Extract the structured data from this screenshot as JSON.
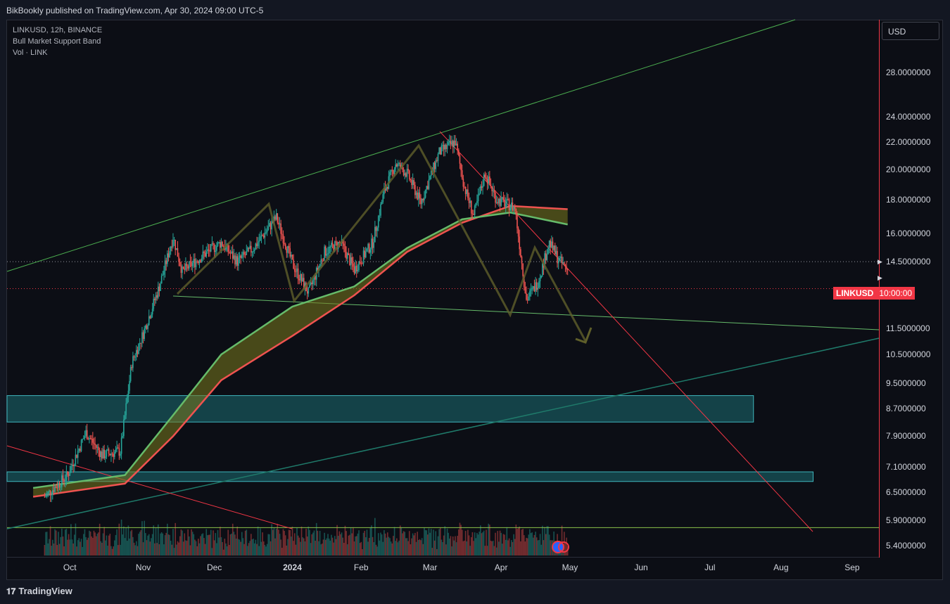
{
  "header": {
    "published": "BikBookly published on TradingView.com, Apr 30, 2024 09:00 UTC-5"
  },
  "legend": {
    "symbol_line": "LINKUSD, 12h, BINANCE",
    "indicator": "Bull Market Support Band",
    "volume": "Vol · LINK"
  },
  "currency": "USD",
  "last_price_label": {
    "symbol": "LINKUSD",
    "countdown": "10:00:00"
  },
  "footer": {
    "brand": "TradingView",
    "logo_icon": "tradingview-logo-icon"
  },
  "colors": {
    "up": "#26a69a",
    "down": "#ef5350",
    "band_fast": "#66bb6a",
    "band_slow": "#ef5350",
    "trendline_green": "#4caf50",
    "trendline_red": "#f23645",
    "zone": "#1b6e73"
  },
  "chart_data": {
    "type": "candlestick",
    "symbol": "LINKUSD",
    "interval": "12h",
    "exchange": "BINANCE",
    "scale": "log",
    "y_tick_labels": [
      "28.0000000",
      "24.0000000",
      "22.0000000",
      "20.0000000",
      "18.0000000",
      "16.0000000",
      "14.5000000",
      "11.5000000",
      "10.5000000",
      "9.5000000",
      "8.7000000",
      "7.9000000",
      "7.1000000",
      "6.5000000",
      "5.9000000",
      "5.4000000"
    ],
    "x_tick_labels": [
      "Oct",
      "Nov",
      "Dec",
      "2024",
      "Feb",
      "Mar",
      "Apr",
      "May",
      "Jun",
      "Jul",
      "Aug",
      "Sep"
    ],
    "price_path": [
      [
        "2023-09-15",
        6.4
      ],
      [
        "2023-09-25",
        6.9
      ],
      [
        "2023-10-03",
        8.0
      ],
      [
        "2023-10-10",
        7.4
      ],
      [
        "2023-10-18",
        7.5
      ],
      [
        "2023-10-23",
        10.2
      ],
      [
        "2023-10-28",
        11.3
      ],
      [
        "2023-11-04",
        13.3
      ],
      [
        "2023-11-10",
        15.8
      ],
      [
        "2023-11-14",
        14.0
      ],
      [
        "2023-11-25",
        15.0
      ],
      [
        "2023-12-01",
        15.5
      ],
      [
        "2023-12-08",
        14.5
      ],
      [
        "2023-12-15",
        15.2
      ],
      [
        "2023-12-25",
        16.9
      ],
      [
        "2024-01-01",
        14.4
      ],
      [
        "2024-01-08",
        13.0
      ],
      [
        "2024-01-15",
        15.0
      ],
      [
        "2024-01-22",
        15.5
      ],
      [
        "2024-01-28",
        14.1
      ],
      [
        "2024-02-05",
        15.5
      ],
      [
        "2024-02-10",
        18.5
      ],
      [
        "2024-02-15",
        20.4
      ],
      [
        "2024-02-20",
        19.7
      ],
      [
        "2024-02-26",
        17.8
      ],
      [
        "2024-03-05",
        21.2
      ],
      [
        "2024-03-12",
        22.0
      ],
      [
        "2024-03-16",
        18.8
      ],
      [
        "2024-03-20",
        17.0
      ],
      [
        "2024-03-25",
        19.7
      ],
      [
        "2024-03-30",
        18.0
      ],
      [
        "2024-04-07",
        17.5
      ],
      [
        "2024-04-12",
        12.7
      ],
      [
        "2024-04-17",
        13.5
      ],
      [
        "2024-04-22",
        15.5
      ],
      [
        "2024-04-26",
        14.6
      ],
      [
        "2024-04-30",
        14.1
      ]
    ],
    "last_price": 14.1,
    "bull_market_support_band": {
      "fast": [
        [
          "2023-09-10",
          6.6
        ],
        [
          "2023-10-20",
          6.9
        ],
        [
          "2023-11-10",
          8.5
        ],
        [
          "2023-12-01",
          10.5
        ],
        [
          "2024-01-01",
          12.4
        ],
        [
          "2024-01-28",
          13.3
        ],
        [
          "2024-02-20",
          15.2
        ],
        [
          "2024-03-15",
          16.8
        ],
        [
          "2024-04-05",
          17.2
        ],
        [
          "2024-04-30",
          16.5
        ]
      ],
      "slow": [
        [
          "2023-09-10",
          6.4
        ],
        [
          "2023-10-20",
          6.7
        ],
        [
          "2023-11-10",
          7.9
        ],
        [
          "2023-12-01",
          9.6
        ],
        [
          "2024-01-01",
          11.2
        ],
        [
          "2024-01-28",
          12.9
        ],
        [
          "2024-02-20",
          15.0
        ],
        [
          "2024-03-15",
          16.6
        ],
        [
          "2024-04-05",
          17.6
        ],
        [
          "2024-04-30",
          17.4
        ]
      ]
    },
    "zones": [
      {
        "from": 8.3,
        "to": 9.1,
        "until": "2024-07-20"
      },
      {
        "from": 6.75,
        "to": 6.98,
        "until": "2024-08-15"
      }
    ],
    "horizontal_levels": [
      14.5,
      13.2,
      5.75
    ],
    "grid": false,
    "legend": "top-left"
  }
}
